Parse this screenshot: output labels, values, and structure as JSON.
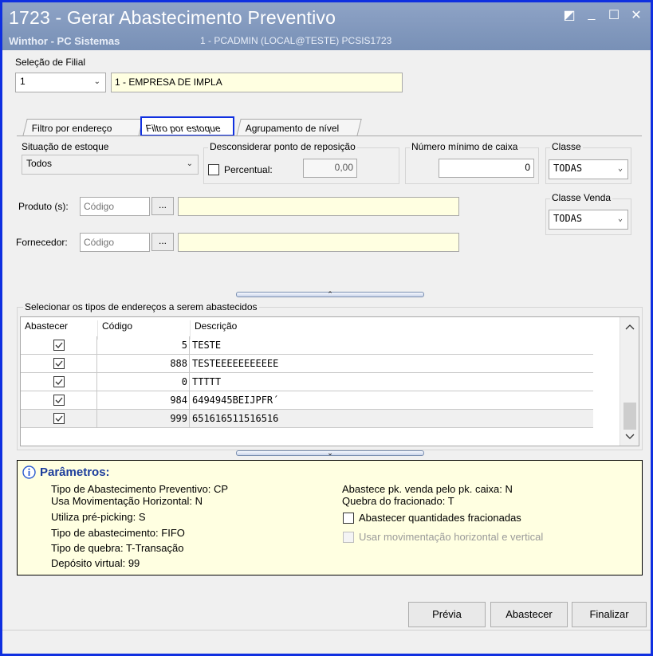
{
  "window": {
    "title": "1723 - Gerar Abastecimento Preventivo",
    "company": "Winthor - PC Sistemas",
    "session": "1 - PCADMIN (LOCAL@TESTE)   PCSIS1723",
    "controls": {
      "restore": "◩",
      "minimize": "_",
      "maximize": "☐",
      "close": "✕"
    }
  },
  "filial": {
    "label": "Seleção de Filial",
    "code": "1",
    "name": "1 - EMPRESA DE IMPLA"
  },
  "tabs": [
    {
      "label": "Filtro por endereço"
    },
    {
      "label": "Filtro por estoque"
    },
    {
      "label": "Agrupamento de nível"
    }
  ],
  "estoque": {
    "situacao_label": "Situação de estoque",
    "situacao_value": "Todos",
    "desconsiderar_label": "Desconsiderar ponto de reposição",
    "percentual_label": "Percentual:",
    "percentual_value": "0,00",
    "numero_label": "Número mínimo de  caixa",
    "numero_value": "0",
    "classe_label": "Classe",
    "classe_value": "TODAS",
    "classe_venda_label": "Classe Venda",
    "classe_venda_value": "TODAS"
  },
  "produto": {
    "label": "Produto (s):",
    "placeholder": "Código",
    "ellipsis": "..."
  },
  "fornecedor": {
    "label": "Fornecedor:",
    "placeholder": "Código",
    "ellipsis": "..."
  },
  "splitter": {
    "up": "⌃",
    "down": "⌄"
  },
  "enderecos": {
    "title": "Selecionar os tipos de endereços a serem abastecidos",
    "columns": [
      "Abastecer",
      "Código",
      "Descrição"
    ],
    "rows": [
      {
        "codigo": "5",
        "descricao": "TESTE"
      },
      {
        "codigo": "888",
        "descricao": "TESTEEEEEEEEEEE"
      },
      {
        "codigo": "0",
        "descricao": "TTTTT"
      },
      {
        "codigo": "984",
        "descricao": "6494945BEIJPFR´"
      },
      {
        "codigo": "999",
        "descricao": "651616511516516"
      }
    ]
  },
  "parametros": {
    "title": "Parâmetros:",
    "left": [
      "Tipo de Abastecimento Preventivo: CP",
      "Usa Movimentação Horizontal: N",
      "Utiliza pré-picking: S",
      "Tipo de abastecimento: FIFO",
      "Tipo de quebra: T-Transação",
      "Depósito virtual: 99"
    ],
    "right": [
      "Abastece pk. venda pelo pk. caixa: N",
      "Quebra do fracionado: T"
    ],
    "check_fracionadas": "Abastecer quantidades fracionadas",
    "check_movimentacao": "Usar movimentação horizontal e vertical"
  },
  "buttons": {
    "previa": "Prévia",
    "abastecer": "Abastecer",
    "finalizar": "Finalizar"
  },
  "colors": {
    "highlight_border": "#1030e0",
    "titlebar": "#8197bd",
    "yellow_field": "#ffffe1"
  }
}
